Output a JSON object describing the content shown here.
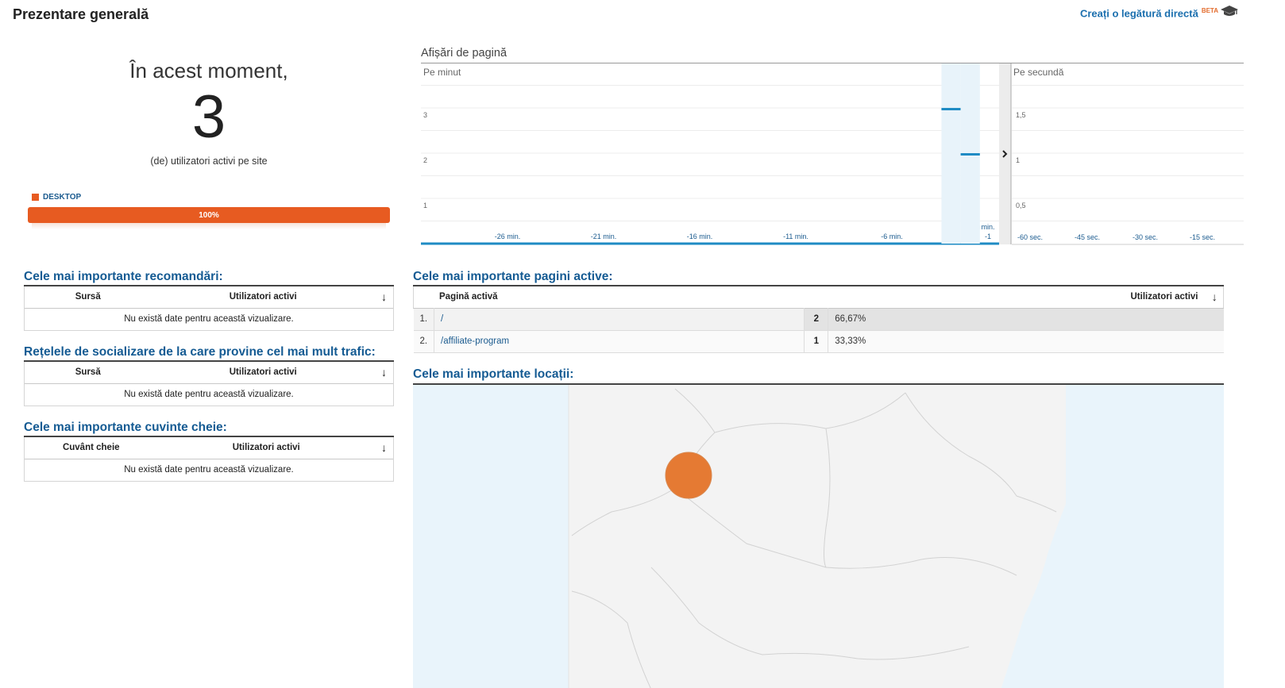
{
  "header": {
    "title": "Prezentare generală",
    "share_link": "Creați o legătură directă",
    "beta_badge": "BETA"
  },
  "realtime": {
    "intro": "În acest moment,",
    "active_users": "3",
    "subtitle": "(de) utilizatori activi pe site",
    "device_label": "DESKTOP",
    "device_percent_label": "100%",
    "device_fraction": 1.0,
    "device_color": "#e75b21"
  },
  "referrals": {
    "title": "Cele mai importante recomandări:",
    "col_source": "Sursă",
    "col_users": "Utilizatori activi",
    "empty": "Nu există date pentru această vizualizare."
  },
  "social": {
    "title": "Rețelele de socializare de la care provine cel mai mult trafic:",
    "col_source": "Sursă",
    "col_users": "Utilizatori activi",
    "empty": "Nu există date pentru această vizualizare."
  },
  "keywords": {
    "title": "Cele mai importante cuvinte cheie:",
    "col_keyword": "Cuvânt cheie",
    "col_users": "Utilizatori activi",
    "empty": "Nu există date pentru această vizualizare."
  },
  "pageviews": {
    "title": "Afișări de pagină",
    "per_minute_label": "Pe minut",
    "per_second_label": "Pe secundă"
  },
  "chart_data": [
    {
      "type": "bar",
      "title": "Pe minut",
      "x_ticks": [
        "-26 min.",
        "-21 min.",
        "-16 min.",
        "-11 min.",
        "-6 min.",
        "min. -1"
      ],
      "y_ticks": [
        "1",
        "2",
        "3"
      ],
      "ylim": [
        0,
        3.5
      ],
      "bars": [
        {
          "minute": -3,
          "value": 3
        },
        {
          "minute": -2,
          "value": 2
        }
      ],
      "grid": true
    },
    {
      "type": "bar",
      "title": "Pe secundă",
      "x_ticks": [
        "-60 sec.",
        "-45 sec.",
        "-30 sec.",
        "-15 sec."
      ],
      "y_ticks": [
        "0,5",
        "1",
        "1,5"
      ],
      "ylim": [
        0,
        1.75
      ],
      "bars": [],
      "grid": true
    }
  ],
  "active_pages": {
    "title": "Cele mai importante pagini active:",
    "col_page": "Pagină activă",
    "col_users": "Utilizatori activi",
    "rows": [
      {
        "index": "1.",
        "path": "/",
        "count": "2",
        "percent": "66,67%"
      },
      {
        "index": "2.",
        "path": "/affiliate-program",
        "count": "1",
        "percent": "33,33%"
      }
    ]
  },
  "locations": {
    "title": "Cele mai importante locații:"
  },
  "colors": {
    "brand_blue": "#155b93",
    "accent_orange": "#e75b21",
    "bar_blue": "#1f8bc4",
    "map_marker": "#e57a33"
  }
}
